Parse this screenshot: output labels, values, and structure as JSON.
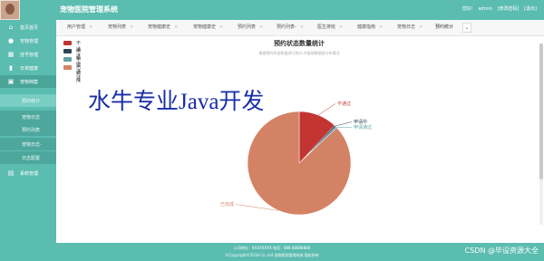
{
  "header": {
    "title": "宠物医院管理系统",
    "links": [
      "您好!",
      "admin",
      "[修改密码]",
      "[退出]"
    ]
  },
  "sidebar": {
    "items": [
      {
        "label": "首页首页",
        "icon": "home-icon"
      },
      {
        "label": "宠物管理",
        "icon": "paw-icon"
      },
      {
        "label": "挂号管理",
        "icon": "calendar-icon"
      },
      {
        "label": "日常健康",
        "icon": "chart-icon"
      },
      {
        "label": "宠物档案",
        "icon": "folder-icon"
      }
    ],
    "subitems": [
      "预约统计",
      "宠物日志",
      "预约列表",
      "宠物日志-",
      "日志配置"
    ],
    "last_item": {
      "label": "系统管理",
      "icon": "document-icon"
    }
  },
  "tabs": [
    "用户管理",
    "宠物列表",
    "宠物健康史",
    "宠物健康史",
    "预约列表",
    "预约列表-",
    "医生排班",
    "健康指南",
    "宠物日志",
    "预约统计"
  ],
  "tab_more": "⌄",
  "watermark": "水牛专业Java开发",
  "chart_data": {
    "type": "pie",
    "title": "预约状态数量统计",
    "subtitle": "根据预约状态数据进行统计,并展现数据各分布情况",
    "legend_position": "top-left",
    "labels": [
      "不通过",
      "申请中",
      "申请通过",
      "已完成"
    ],
    "values": [
      12,
      0.5,
      0.5,
      87
    ],
    "colors": [
      "#c23531",
      "#2f4554",
      "#61a0a8",
      "#d48265"
    ]
  },
  "footer": {
    "line1": "公司地址：XXXXXXXX 电话：888 88888888",
    "line2": "©Copyright©2018 Co.,Ltd 宠物医院管理系统 版权所有"
  },
  "csdn": "CSDN @毕设资源大全"
}
